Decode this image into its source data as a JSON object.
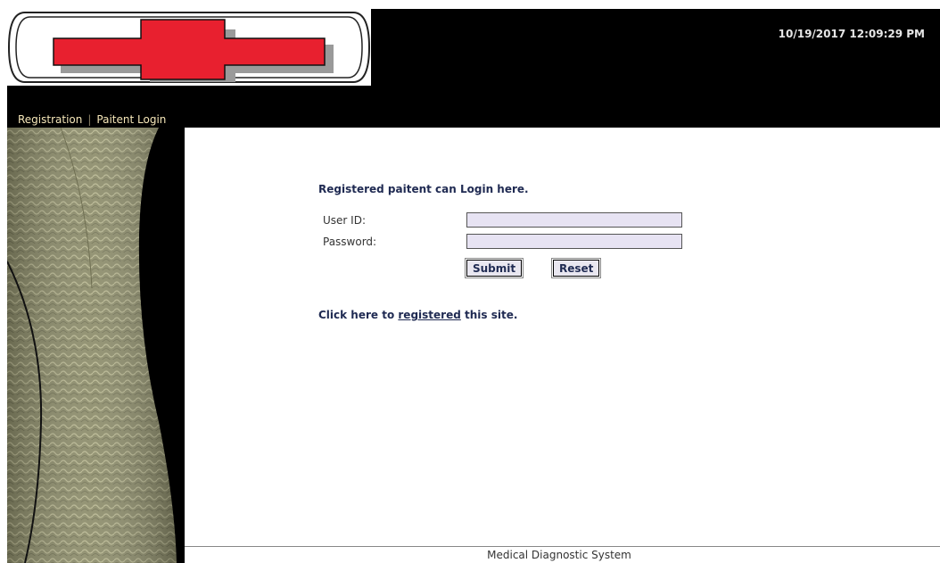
{
  "header": {
    "datetime": "10/19/2017 12:09:29 PM",
    "logo_icon": "red-cross-logo-icon"
  },
  "nav": {
    "items": [
      {
        "label": "Registration"
      },
      {
        "label": "Paitent Login"
      }
    ],
    "separator": "|"
  },
  "login": {
    "title": "Registered paitent can Login here.",
    "user_id_label": "User ID:",
    "user_id_value": "",
    "password_label": "Password:",
    "password_value": "",
    "submit_label": "Submit",
    "reset_label": "Reset"
  },
  "register": {
    "prefix": "Click here to ",
    "link": "registered",
    "suffix": " this site."
  },
  "footer": {
    "text": "Medical Diagnostic System"
  },
  "colors": {
    "header_bg": "#000000",
    "cross_red": "#e8202f",
    "heading_text": "#1f2a52",
    "input_bg": "#e7e3f3",
    "nav_text": "#f5e6b8"
  }
}
